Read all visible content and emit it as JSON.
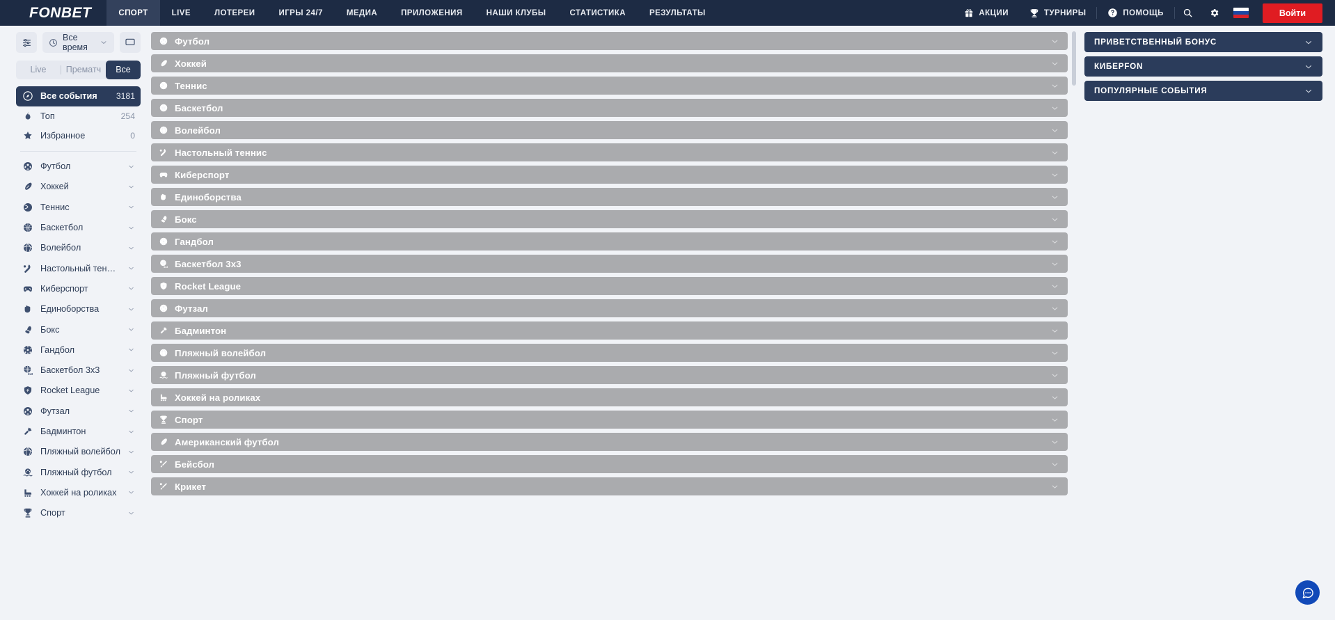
{
  "header": {
    "logo": "FONBET",
    "nav": [
      {
        "label": "СПОРТ",
        "active": true
      },
      {
        "label": "LIVE",
        "active": false
      },
      {
        "label": "ЛОТЕРЕИ",
        "active": false
      },
      {
        "label": "ИГРЫ 24/7",
        "active": false
      },
      {
        "label": "МЕДИА",
        "active": false
      },
      {
        "label": "ПРИЛОЖЕНИЯ",
        "active": false
      },
      {
        "label": "НАШИ КЛУБЫ",
        "active": false
      },
      {
        "label": "СТАТИСТИКА",
        "active": false
      },
      {
        "label": "РЕЗУЛЬТАТЫ",
        "active": false
      }
    ],
    "promos_label": "АКЦИИ",
    "promos_icon": "gift-icon",
    "tournaments_label": "ТУРНИРЫ",
    "tournaments_icon": "trophy-icon",
    "help_label": "ПОМОЩЬ",
    "help_icon": "question-circle-icon",
    "search_icon": "search-icon",
    "settings_icon": "gear-icon",
    "language_icon": "russian-flag-icon",
    "login_label": "Войти",
    "login_color": "#e01c22",
    "background_color": "#1d2b44"
  },
  "sidebar": {
    "filters_icon": "sliders-icon",
    "time_filter": {
      "icon": "clock-icon",
      "value": "Все время",
      "chevron": "chevron-down-icon"
    },
    "display_mode_icon": "monitor-icon",
    "segmented": [
      {
        "label": "Live",
        "active": false
      },
      {
        "label": "Прематч",
        "active": false
      },
      {
        "label": "Все",
        "active": true
      }
    ],
    "primary": [
      {
        "label": "Все события",
        "count": "3181",
        "icon": "compass-icon",
        "selected": true
      },
      {
        "label": "Топ",
        "count": "254",
        "icon": "flame-icon",
        "selected": false
      },
      {
        "label": "Избранное",
        "count": "0",
        "icon": "star-icon",
        "selected": false
      }
    ],
    "sports": [
      {
        "label": "Футбол",
        "icon": "soccer-ball-icon"
      },
      {
        "label": "Хоккей",
        "icon": "hockey-puck-icon"
      },
      {
        "label": "Теннис",
        "icon": "tennis-ball-icon"
      },
      {
        "label": "Баскетбол",
        "icon": "basketball-icon"
      },
      {
        "label": "Волейбол",
        "icon": "volleyball-icon"
      },
      {
        "label": "Настольный теннис",
        "icon": "table-tennis-icon"
      },
      {
        "label": "Киберспорт",
        "icon": "gamepad-icon"
      },
      {
        "label": "Единоборства",
        "icon": "fist-icon"
      },
      {
        "label": "Бокс",
        "icon": "boxing-glove-icon"
      },
      {
        "label": "Гандбол",
        "icon": "handball-icon"
      },
      {
        "label": "Баскетбол 3х3",
        "icon": "basketball-3x3-icon"
      },
      {
        "label": "Rocket League",
        "icon": "rocket-league-icon"
      },
      {
        "label": "Футзал",
        "icon": "futsal-ball-icon"
      },
      {
        "label": "Бадминтон",
        "icon": "badminton-icon"
      },
      {
        "label": "Пляжный волейбол",
        "icon": "beach-volleyball-icon"
      },
      {
        "label": "Пляжный футбол",
        "icon": "beach-soccer-icon"
      },
      {
        "label": "Хоккей на роликах",
        "icon": "roller-hockey-icon"
      },
      {
        "label": "Спорт",
        "icon": "trophy-icon"
      }
    ],
    "row_chevron": "chevron-down-icon"
  },
  "main": {
    "rows": [
      {
        "label": "Футбол",
        "icon": "soccer-ball-icon"
      },
      {
        "label": "Хоккей",
        "icon": "hockey-puck-icon"
      },
      {
        "label": "Теннис",
        "icon": "tennis-ball-icon"
      },
      {
        "label": "Баскетбол",
        "icon": "basketball-icon"
      },
      {
        "label": "Волейбол",
        "icon": "volleyball-icon"
      },
      {
        "label": "Настольный теннис",
        "icon": "table-tennis-icon"
      },
      {
        "label": "Киберспорт",
        "icon": "gamepad-icon"
      },
      {
        "label": "Единоборства",
        "icon": "fist-icon"
      },
      {
        "label": "Бокс",
        "icon": "boxing-glove-icon"
      },
      {
        "label": "Гандбол",
        "icon": "handball-icon"
      },
      {
        "label": "Баскетбол 3х3",
        "icon": "basketball-3x3-icon"
      },
      {
        "label": "Rocket League",
        "icon": "rocket-league-icon"
      },
      {
        "label": "Футзал",
        "icon": "futsal-ball-icon"
      },
      {
        "label": "Бадминтон",
        "icon": "badminton-icon"
      },
      {
        "label": "Пляжный волейбол",
        "icon": "beach-volleyball-icon"
      },
      {
        "label": "Пляжный футбол",
        "icon": "beach-soccer-icon"
      },
      {
        "label": "Хоккей на роликах",
        "icon": "roller-hockey-icon"
      },
      {
        "label": "Спорт",
        "icon": "trophy-icon"
      },
      {
        "label": "Американский футбол",
        "icon": "american-football-icon"
      },
      {
        "label": "Бейсбол",
        "icon": "baseball-icon"
      },
      {
        "label": "Крикет",
        "icon": "cricket-icon"
      }
    ],
    "row_chevron": "chevron-down-icon",
    "row_color": "#aaabae"
  },
  "right_panel": {
    "panels": [
      {
        "label": "ПРИВЕТСТВЕННЫЙ БОНУС"
      },
      {
        "label": "КИБЕРFON"
      },
      {
        "label": "ПОПУЛЯРНЫЕ СОБЫТИЯ"
      }
    ],
    "chevron": "chevron-down-icon",
    "panel_color": "#2b3c5b"
  },
  "chat": {
    "icon": "chat-bubble-icon",
    "color": "#1149b8"
  }
}
